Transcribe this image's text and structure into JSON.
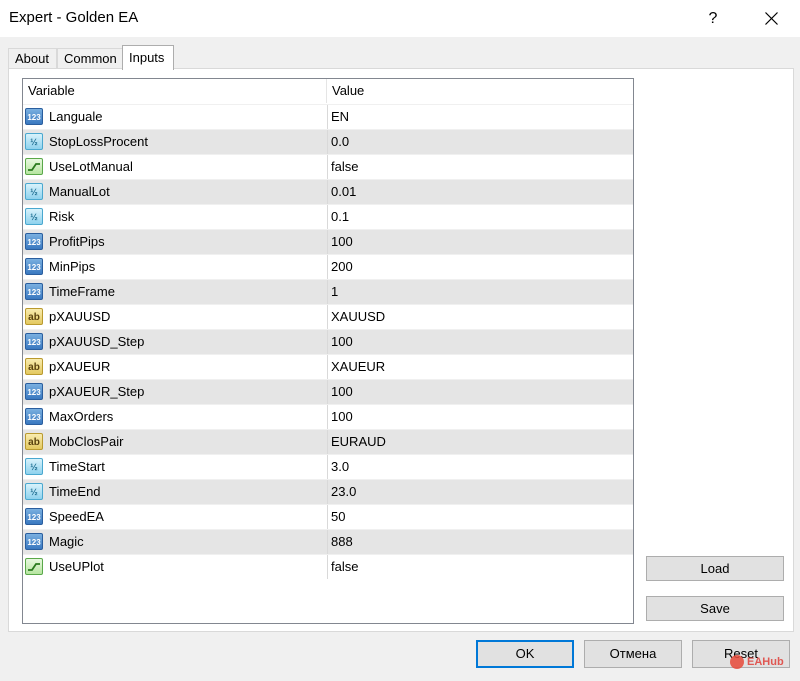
{
  "window": {
    "title": "Expert - Golden EA",
    "help_label": "?"
  },
  "tabs": [
    {
      "label": "About",
      "active": false
    },
    {
      "label": "Common",
      "active": false
    },
    {
      "label": "Inputs",
      "active": true
    }
  ],
  "grid": {
    "columns": {
      "variable": "Variable",
      "value": "Value"
    },
    "rows": [
      {
        "type": "int",
        "icon_text": "123",
        "name": "Languale",
        "value": "EN"
      },
      {
        "type": "double",
        "icon_text": "½",
        "name": "StopLossProcent",
        "value": "0.0"
      },
      {
        "type": "bool",
        "icon_text": "",
        "name": "UseLotManual",
        "value": "false"
      },
      {
        "type": "double",
        "icon_text": "½",
        "name": "ManualLot",
        "value": "0.01"
      },
      {
        "type": "double",
        "icon_text": "½",
        "name": "Risk",
        "value": "0.1"
      },
      {
        "type": "int",
        "icon_text": "123",
        "name": "ProfitPips",
        "value": "100"
      },
      {
        "type": "int",
        "icon_text": "123",
        "name": "MinPips",
        "value": "200"
      },
      {
        "type": "int",
        "icon_text": "123",
        "name": "TimeFrame",
        "value": "1"
      },
      {
        "type": "string",
        "icon_text": "ab",
        "name": "pXAUUSD",
        "value": "XAUUSD"
      },
      {
        "type": "int",
        "icon_text": "123",
        "name": "pXAUUSD_Step",
        "value": "100"
      },
      {
        "type": "string",
        "icon_text": "ab",
        "name": "pXAUEUR",
        "value": "XAUEUR"
      },
      {
        "type": "int",
        "icon_text": "123",
        "name": "pXAUEUR_Step",
        "value": "100"
      },
      {
        "type": "int",
        "icon_text": "123",
        "name": "MaxOrders",
        "value": "100"
      },
      {
        "type": "string",
        "icon_text": "ab",
        "name": "MobClosPair",
        "value": "EURAUD"
      },
      {
        "type": "double",
        "icon_text": "½",
        "name": "TimeStart",
        "value": "3.0"
      },
      {
        "type": "double",
        "icon_text": "½",
        "name": "TimeEnd",
        "value": "23.0"
      },
      {
        "type": "int",
        "icon_text": "123",
        "name": "SpeedEA",
        "value": "50"
      },
      {
        "type": "int",
        "icon_text": "123",
        "name": "Magic",
        "value": "888"
      },
      {
        "type": "bool",
        "icon_text": "",
        "name": "UseUPlot",
        "value": "false"
      }
    ]
  },
  "side_buttons": {
    "load": "Load",
    "save": "Save"
  },
  "footer_buttons": {
    "ok": "OK",
    "cancel": "Отмена",
    "reset": "Reset"
  },
  "watermark": "EAHub",
  "colors": {
    "accent": "#0078d7",
    "row_alt": "#e5e5e5",
    "window_bg": "#f0f0f0"
  }
}
